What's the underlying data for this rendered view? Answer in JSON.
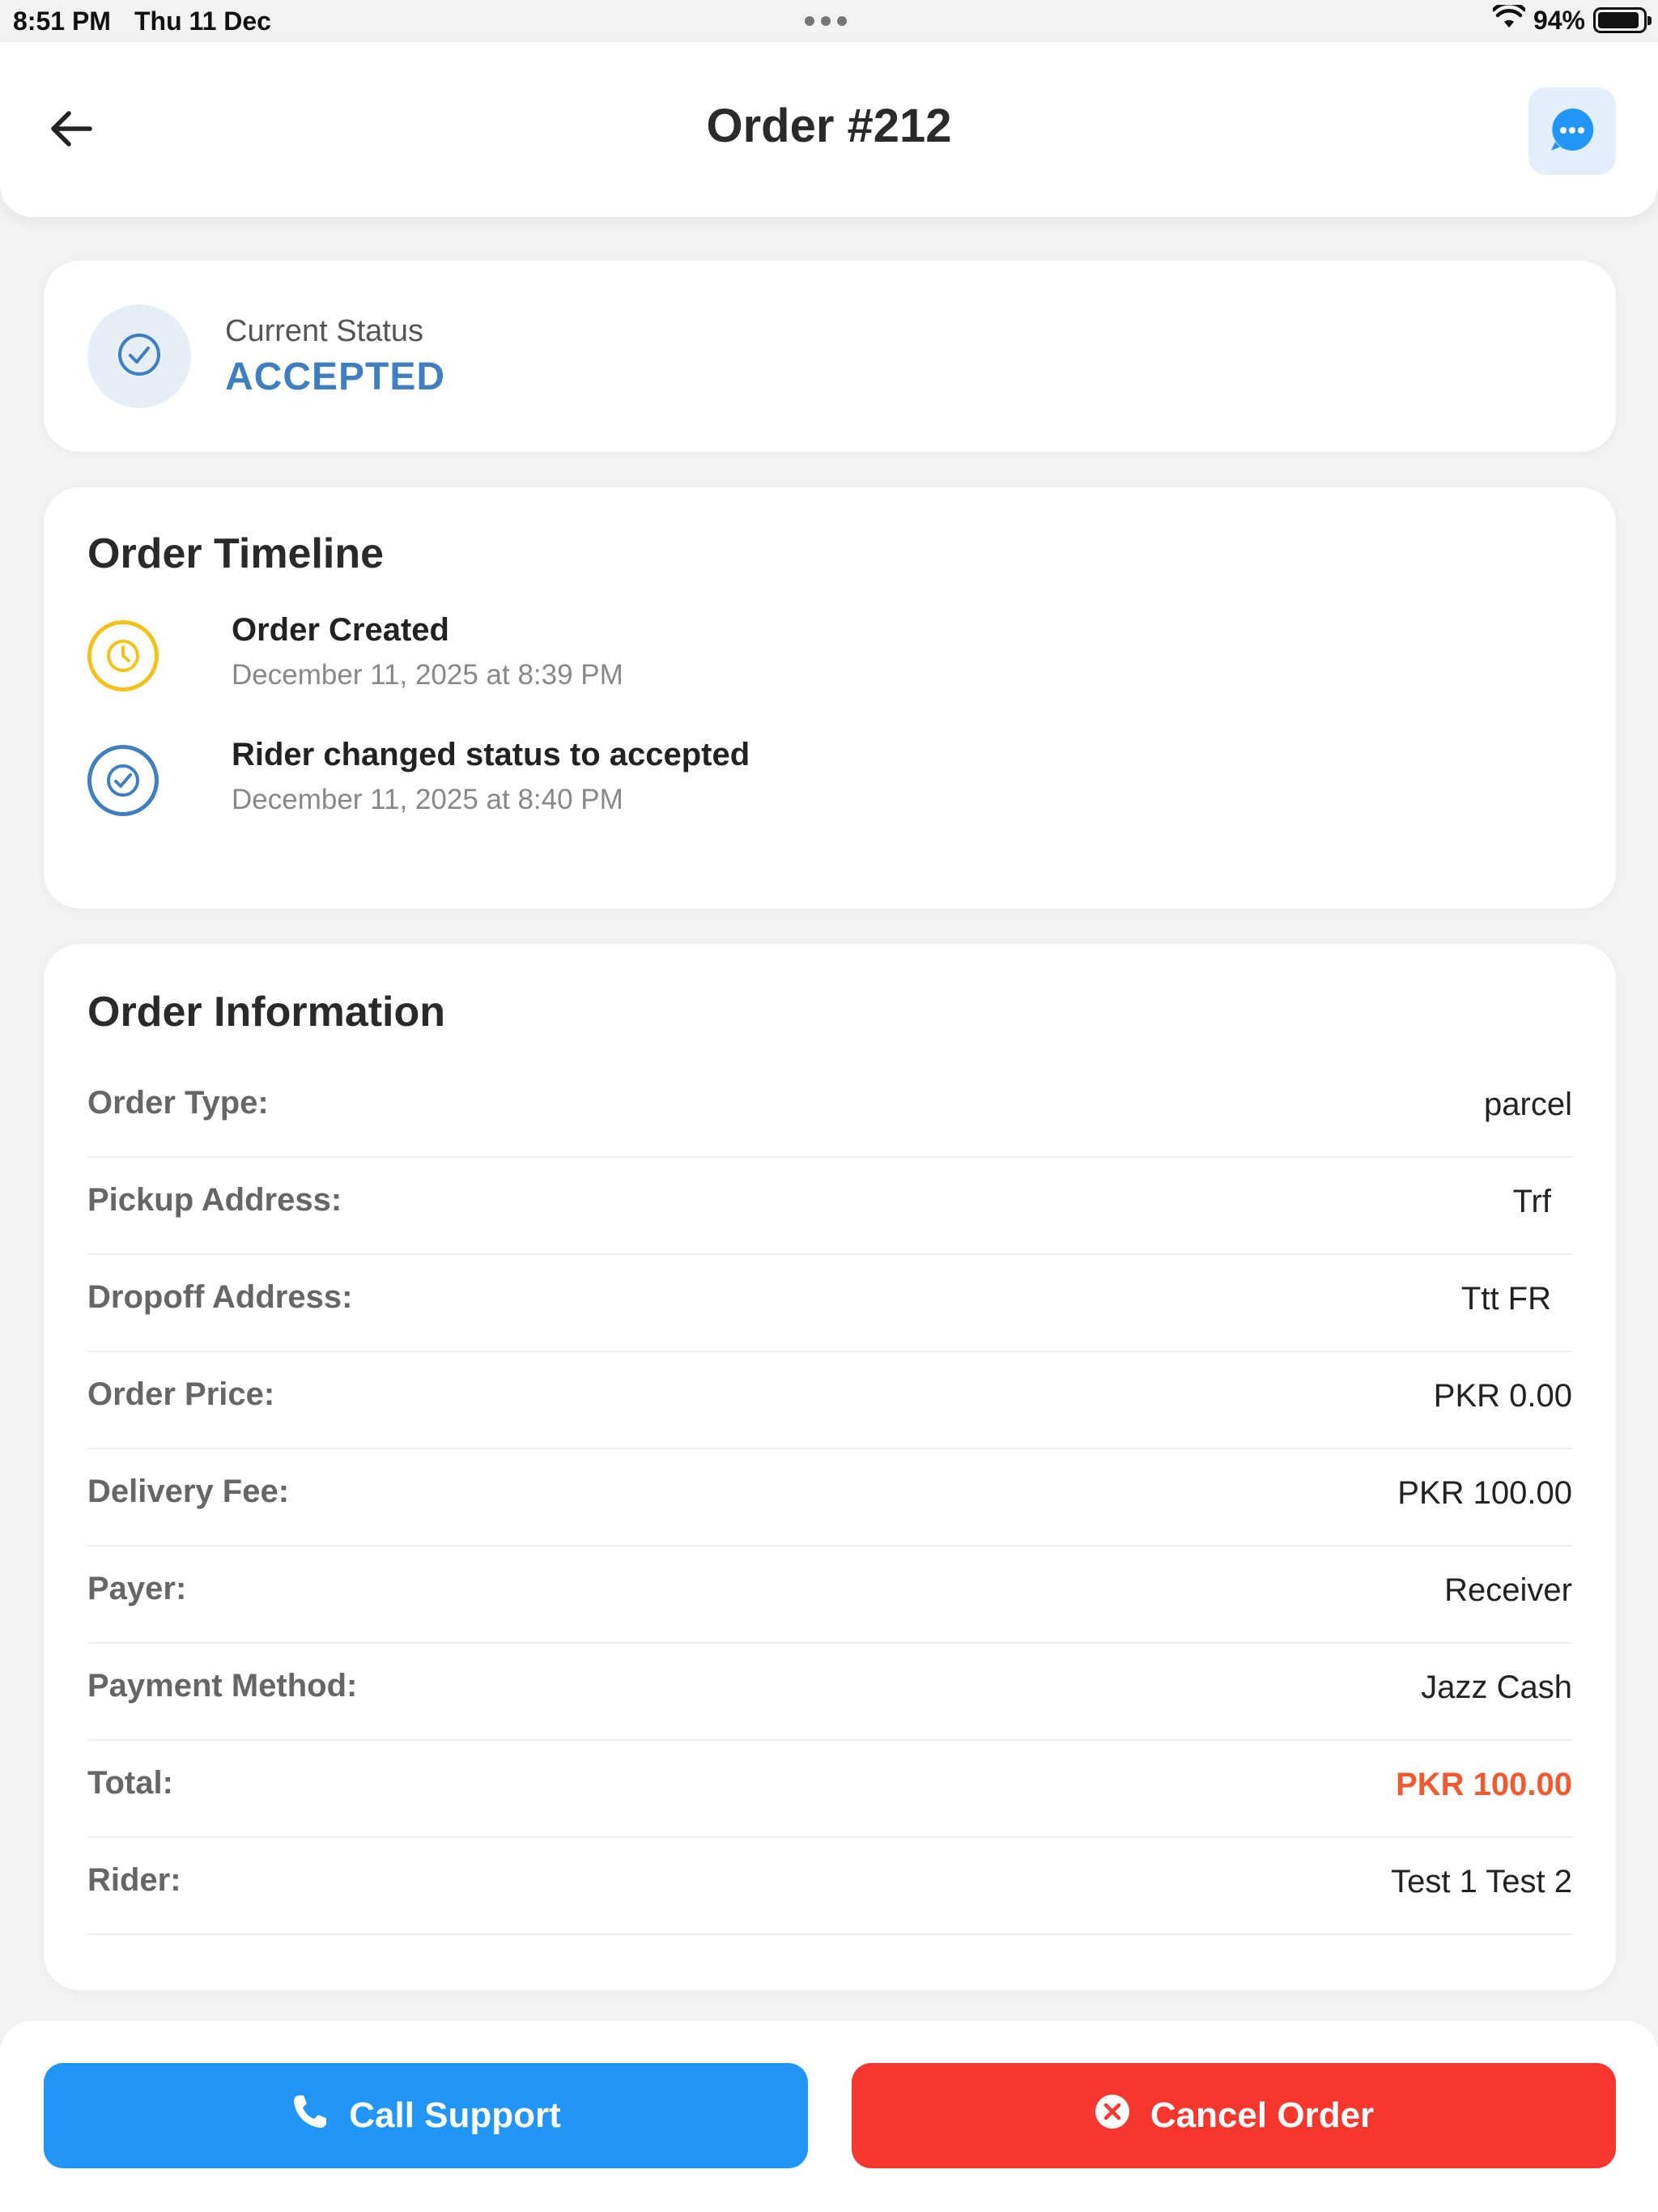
{
  "status_bar": {
    "time": "8:51 PM",
    "date": "Thu 11 Dec",
    "battery": "94%"
  },
  "header": {
    "title": "Order #212"
  },
  "status_card": {
    "label": "Current Status",
    "value": "ACCEPTED"
  },
  "timeline": {
    "heading": "Order Timeline",
    "items": [
      {
        "title": "Order Created",
        "time": "December 11, 2025 at 8:39 PM",
        "icon": "clock-icon",
        "color": "#f2c21b"
      },
      {
        "title": "Rider changed status to accepted",
        "time": "December 11, 2025 at 8:40 PM",
        "icon": "check-circle-icon",
        "color": "#3f7fbf"
      }
    ]
  },
  "order_info": {
    "heading": "Order Information",
    "rows": [
      {
        "label": "Order Type:",
        "value": "parcel"
      },
      {
        "label": "Pickup Address:",
        "value": "Trf"
      },
      {
        "label": "Dropoff Address:",
        "value": "Ttt FR"
      },
      {
        "label": "Order Price:",
        "value": "PKR 0.00"
      },
      {
        "label": "Delivery Fee:",
        "value": "PKR 100.00"
      },
      {
        "label": "Payer:",
        "value": "Receiver"
      },
      {
        "label": "Payment Method:",
        "value": "Jazz Cash"
      },
      {
        "label": "Total:",
        "value": "PKR 100.00"
      },
      {
        "label": "Rider:",
        "value": "Test 1 Test 2"
      }
    ]
  },
  "actions": {
    "call_support": "Call Support",
    "cancel_order": "Cancel Order"
  },
  "colors": {
    "accent_blue": "#2196f6",
    "status_blue": "#3f7fbf",
    "cancel_red": "#f6372e",
    "total_orange": "#f05a2f"
  }
}
